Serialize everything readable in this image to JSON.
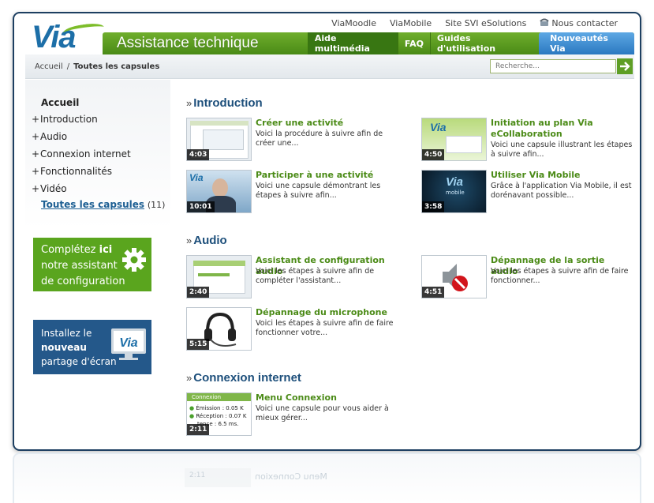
{
  "header": {
    "logo_text": "Via",
    "title": "Assistance technique",
    "top_links": [
      "ViaMoodle",
      "ViaMobile",
      "Site SVI eSolutions"
    ],
    "contact_label": "Nous contacter",
    "nav": [
      "Aide multimédia",
      "FAQ",
      "Guides d'utilisation",
      "Nouveautés Via"
    ]
  },
  "breadcrumb": {
    "home": "Accueil",
    "separator": "/",
    "current": "Toutes les capsules"
  },
  "search": {
    "placeholder": "Recherche..."
  },
  "sidebar": {
    "home": "Accueil",
    "items": [
      {
        "prefix": "+",
        "label": "Introduction"
      },
      {
        "prefix": "+",
        "label": "Audio"
      },
      {
        "prefix": "+",
        "label": "Connexion internet"
      },
      {
        "prefix": "+",
        "label": "Fonctionnalités"
      },
      {
        "prefix": "+",
        "label": "Vidéo"
      }
    ],
    "all_label": "Toutes les capsules",
    "all_count": "(11)"
  },
  "promo_config": {
    "line1_a": "Complétez ",
    "line1_b": "ici",
    "line2": "notre assistant",
    "line3": "de configuration"
  },
  "promo_share": {
    "line1": "Installez le",
    "line2": "nouveau",
    "line3": "partage d'écran",
    "icon_text": "Via"
  },
  "sections": {
    "intro": {
      "arrow": "»",
      "title": "Introduction",
      "cards": [
        {
          "duration": "4:03",
          "title": "Créer une activité",
          "desc": "Voici la procédure à suivre afin de créer une..."
        },
        {
          "duration": "4:50",
          "title": "Initiation au plan Via eCollaboration",
          "desc": "Voici une capsule illustrant les étapes à suivre afin..."
        },
        {
          "duration": "10:01",
          "title": "Participer à une activité",
          "desc": "Voici une capsule démontrant les étapes à suivre afin..."
        },
        {
          "duration": "3:58",
          "title": "Utiliser Via Mobile",
          "desc": "Grâce à l'application Via Mobile, il est dorénavant possible..."
        }
      ]
    },
    "audio": {
      "arrow": "»",
      "title": "Audio",
      "cards": [
        {
          "duration": "2:40",
          "title": "Assistant de configuration audio",
          "desc": "Voici les étapes à suivre afin de compléter l'assistant..."
        },
        {
          "duration": "4:51",
          "title": "Dépannage de la sortie audio",
          "desc": "Voici les étapes à suivre afin de faire fonctionner..."
        },
        {
          "duration": "5:15",
          "title": "Dépannage du microphone",
          "desc": "Voici les étapes à suivre afin de faire fonctionner votre..."
        }
      ]
    },
    "connexion": {
      "arrow": "»",
      "title": "Connexion internet",
      "cards": [
        {
          "duration": "2:11",
          "title": "Menu Connexion",
          "desc": "Voici une capsule pour vous aider à mieux gérer..."
        }
      ]
    }
  },
  "thumb_texts": {
    "connexion_header": "Connexion",
    "connexion_l1": "Émission : 0.05 K",
    "connexion_l2": "Réception : 0.07 K",
    "connexion_l3": "tence : 6.5 ms.",
    "mobile_logo": "Via",
    "mobile_word": "mobile",
    "ecollab_logo": "Via",
    "participer_logo": "Via"
  },
  "reflection": {
    "duration": "2:11",
    "title": "Menu Connexion"
  },
  "colors": {
    "brand_green": "#5aa51e",
    "brand_blue": "#24588a",
    "title_green": "#4b8b17",
    "section_blue": "#1d4f7b"
  }
}
